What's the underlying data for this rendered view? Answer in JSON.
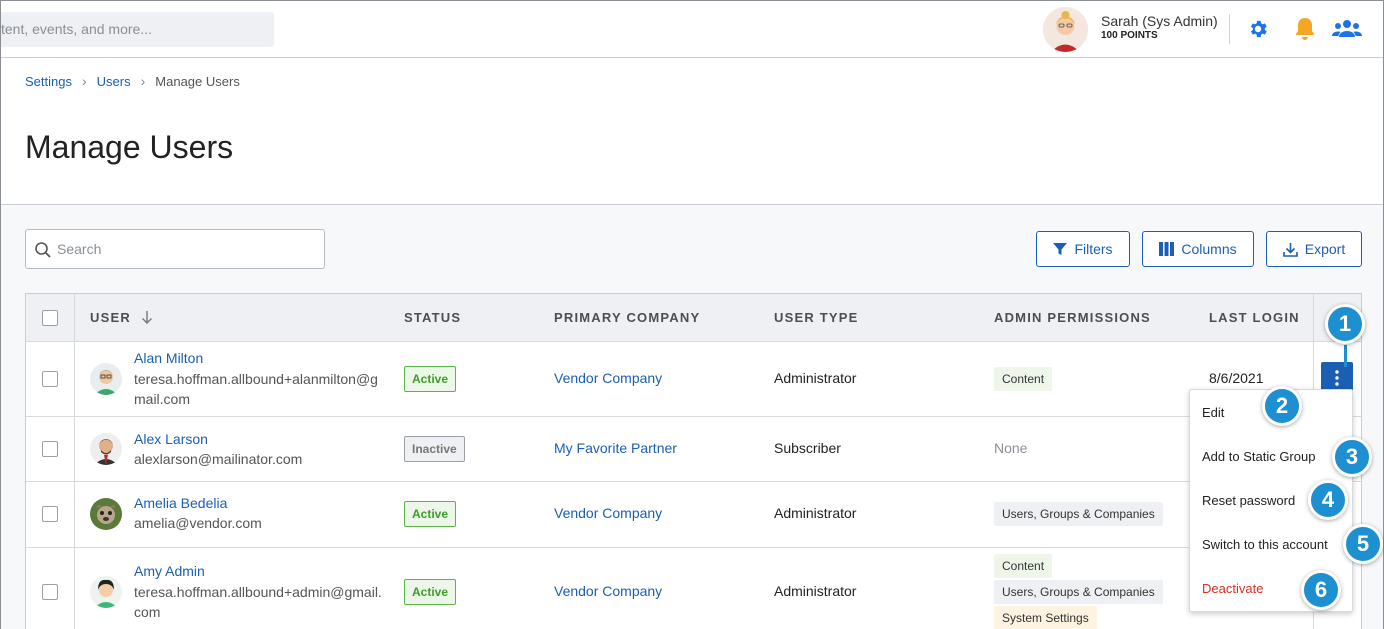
{
  "header": {
    "search_placeholder": "tent, events, and more...",
    "user_name": "Sarah (Sys Admin)",
    "user_points": "100 POINTS",
    "icons": [
      "settings-gear-icon",
      "notification-bell-icon",
      "users-group-icon"
    ],
    "colors": {
      "gear": "#1a73e8",
      "bell": "#f5a623",
      "users": "#1a73e8"
    }
  },
  "breadcrumb": {
    "items": [
      "Settings",
      "Users"
    ],
    "current": "Manage Users"
  },
  "page": {
    "title": "Manage Users"
  },
  "toolbar": {
    "search_placeholder": "Search",
    "filters_label": "Filters",
    "columns_label": "Columns",
    "export_label": "Export"
  },
  "table": {
    "headers": [
      "USER",
      "STATUS",
      "PRIMARY COMPANY",
      "USER TYPE",
      "ADMIN PERMISSIONS",
      "LAST LOGIN"
    ],
    "rows": [
      {
        "name": "Alan Milton",
        "email": "teresa.hoffman.allbound+alanmilton@gmail.com",
        "status": "Active",
        "company": "Vendor Company",
        "type": "Administrator",
        "permissions": [
          "Content"
        ],
        "last_login": "8/6/2021"
      },
      {
        "name": "Alex Larson",
        "email": "alexlarson@mailinator.com",
        "status": "Inactive",
        "company": "My Favorite Partner",
        "type": "Subscriber",
        "permissions_text": "None",
        "last_login": ""
      },
      {
        "name": "Amelia Bedelia",
        "email": "amelia@vendor.com",
        "status": "Active",
        "company": "Vendor Company",
        "type": "Administrator",
        "permissions": [
          "Users, Groups & Companies"
        ],
        "last_login": ""
      },
      {
        "name": "Amy Admin",
        "email": "teresa.hoffman.allbound+admin@gmail.com",
        "status": "Active",
        "company": "Vendor Company",
        "type": "Administrator",
        "permissions": [
          "Content",
          "Users, Groups & Companies",
          "System Settings"
        ],
        "last_login": ""
      }
    ]
  },
  "row_menu": {
    "items": [
      "Edit",
      "Add to Static Group",
      "Reset password",
      "Switch to this account"
    ],
    "danger_item": "Deactivate"
  },
  "callouts": [
    "1",
    "2",
    "3",
    "4",
    "5",
    "6"
  ]
}
